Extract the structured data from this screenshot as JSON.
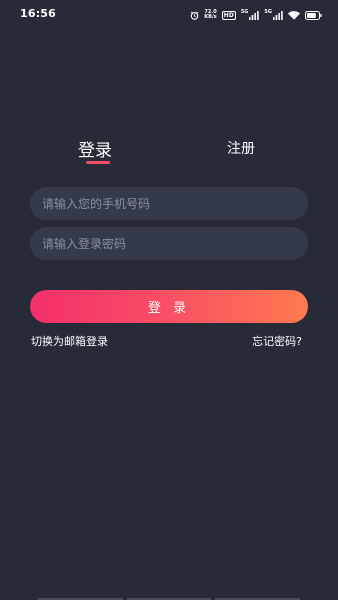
{
  "status_bar": {
    "time": "16:56",
    "net_speed_value": "72.0",
    "net_speed_unit": "KB/s",
    "hd_label": "HD",
    "net_label_1": "5G",
    "net_label_2": "5G",
    "battery_level": 0.8
  },
  "tabs": {
    "login": "登录",
    "register": "注册",
    "active": "login"
  },
  "form": {
    "phone_placeholder": "请输入您的手机号码",
    "password_placeholder": "请输入登录密码",
    "phone_value": "",
    "password_value": ""
  },
  "login_button": "登 录",
  "links": {
    "switch_email": "切换为邮箱登录",
    "forgot_password": "忘记密码?"
  },
  "colors": {
    "background": "#272B38",
    "field_background": "#353A4A",
    "accent": "#F24A6A",
    "button_gradient_start": "#F42F6A",
    "button_gradient_end": "#FF7A4F"
  }
}
